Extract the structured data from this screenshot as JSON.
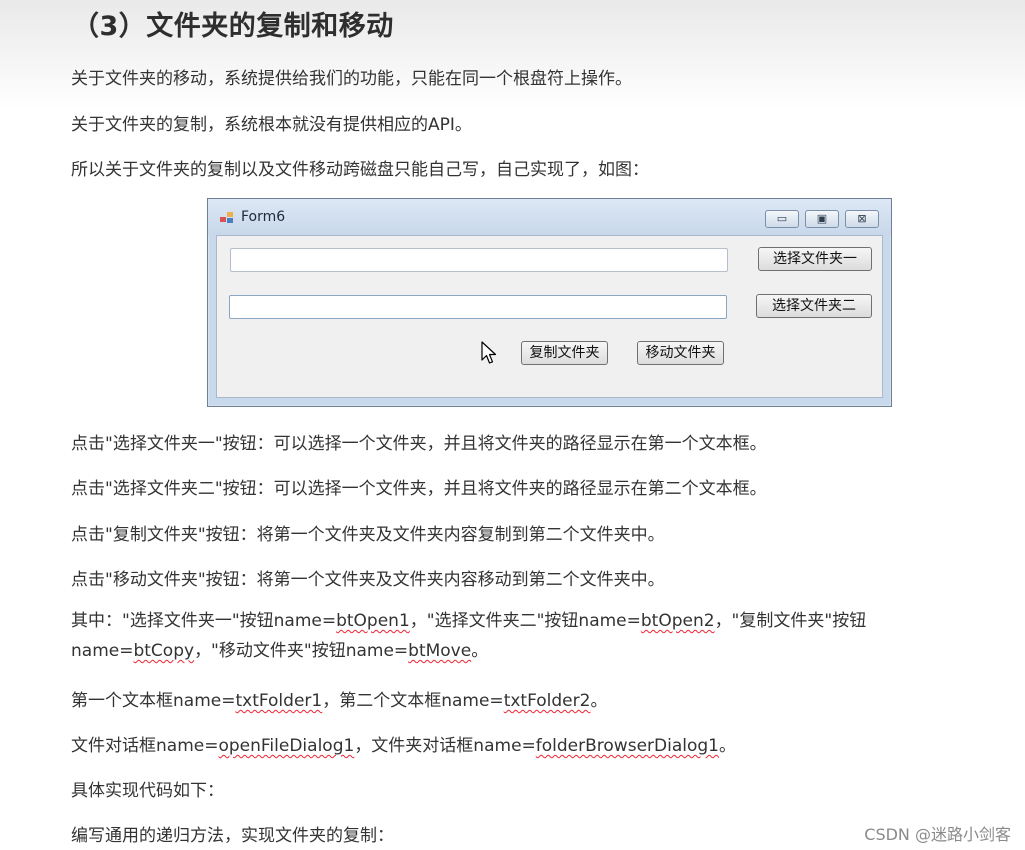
{
  "heading": "（3）文件夹的复制和移动",
  "intro": [
    "关于文件夹的移动，系统提供给我们的功能，只能在同一个根盘符上操作。",
    "关于文件夹的复制，系统根本就没有提供相应的API。",
    "所以关于文件夹的复制以及文件移动跨磁盘只能自己写，自己实现了，如图："
  ],
  "form": {
    "title": "Form6",
    "btn_minimize": "▭",
    "btn_maximize": "▣",
    "btn_close": "⊠",
    "textbox1_value": "",
    "textbox2_value": "",
    "btn_select1": "选择文件夹一",
    "btn_select2": "选择文件夹二",
    "btn_copy": "复制文件夹",
    "btn_move": "移动文件夹"
  },
  "desc": [
    "点击\"选择文件夹一\"按钮：可以选择一个文件夹，并且将文件夹的路径显示在第一个文本框。",
    "点击\"选择文件夹二\"按钮：可以选择一个文件夹，并且将文件夹的路径显示在第二个文本框。",
    "点击\"复制文件夹\"按钮：将第一个文件夹及文件夹内容复制到第二个文件夹中。",
    "点击\"移动文件夹\"按钮：将第一个文件夹及文件夹内容移动到第二个文件夹中。"
  ],
  "names": {
    "p1": {
      "a": "其中：\"选择文件夹一\"按钮name=",
      "b": "btOpen1",
      "c": "，\"选择文件夹二\"按钮name=",
      "d": "btOpen2",
      "e": "，\"复制文件夹\"按钮",
      "f": "name=",
      "g": "btCopy",
      "h": "，\"移动文件夹\"按钮name=",
      "i": "btMove",
      "j": "。"
    },
    "p2": {
      "a": "第一个文本框name=",
      "b": "txtFolder1",
      "c": "，第二个文本框name=",
      "d": "txtFolder2",
      "e": "。"
    },
    "p3": {
      "a": "文件对话框name=",
      "b": "openFileDialog1",
      "c": "，文件夹对话框name=",
      "d": "folderBrowserDialog1",
      "e": "。"
    }
  },
  "code_intro": "具体实现代码如下：",
  "recursive_intro": "编写通用的递归方法，实现文件夹的复制：",
  "watermark": "CSDN @迷路小剑客"
}
